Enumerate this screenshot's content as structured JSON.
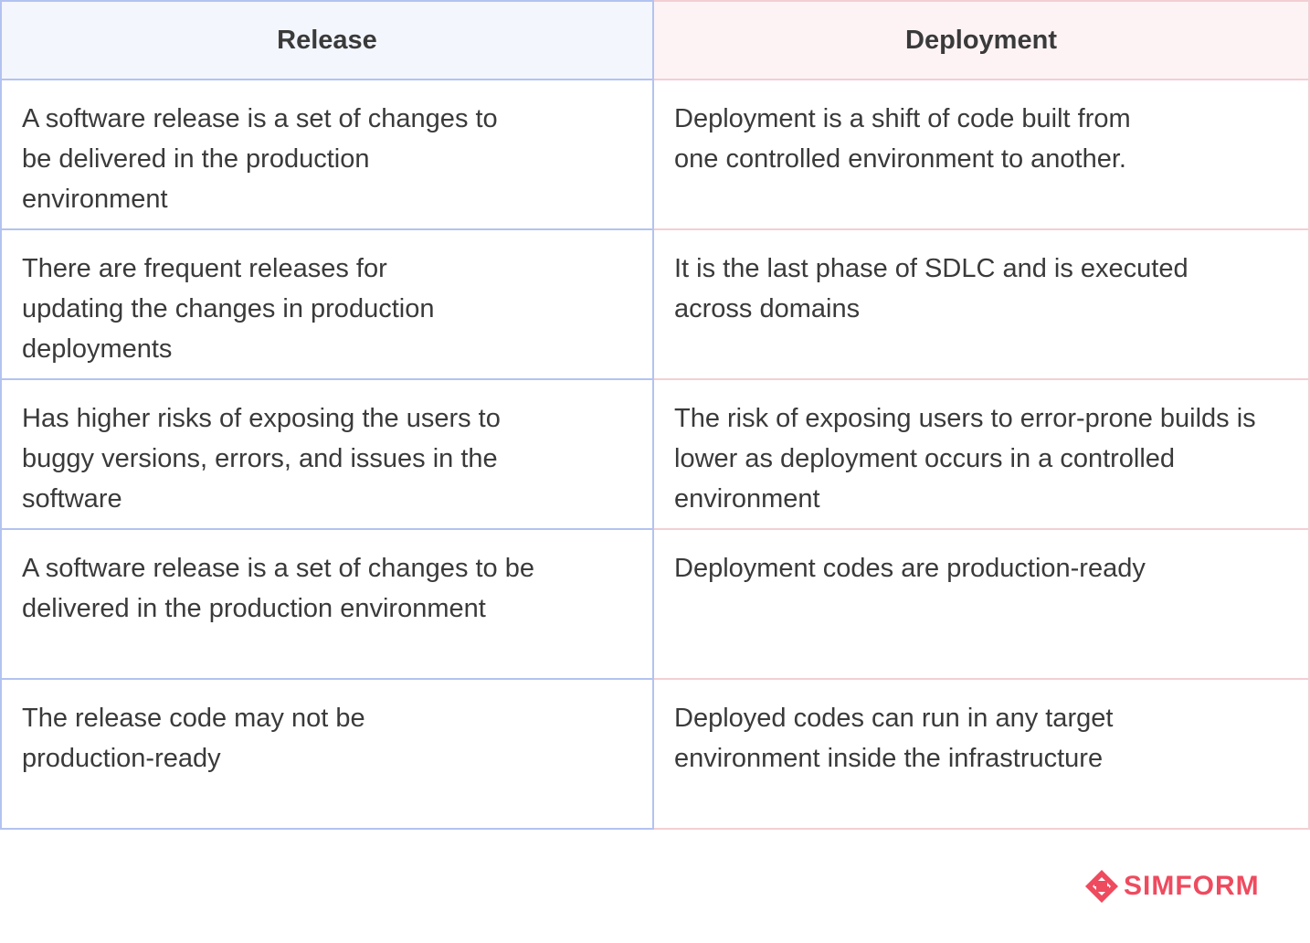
{
  "table": {
    "headers": {
      "release": "Release",
      "deployment": "Deployment"
    },
    "rows": [
      {
        "release": "A software release is a set of changes to be delivered in the production environment",
        "deployment": "Deployment is a shift of code built from one controlled environment to another."
      },
      {
        "release": "There are frequent releases for updating the changes in production deployments",
        "deployment": "It is the last phase of SDLC and is executed across domains"
      },
      {
        "release": "Has higher risks of exposing the users to buggy versions, errors, and issues in the software",
        "deployment": "The risk of exposing users to error-prone builds is lower as deployment occurs in a controlled environment"
      },
      {
        "release": "A software release is a set of changes to be delivered in the production environment",
        "deployment": "Deployment codes are production-ready"
      },
      {
        "release": "The release code may not be production-ready",
        "deployment": "Deployed codes can run in any target environment inside the infrastructure"
      }
    ]
  },
  "logo": {
    "text": "SIMFORM",
    "icon": "simform-logo-icon",
    "color": "#ee4b5f"
  },
  "colors": {
    "release_border": "#b3c3f0",
    "release_header_bg": "#f3f6fd",
    "deployment_border": "#f2cfd4",
    "deployment_header_bg": "#fdf3f5",
    "text": "#3a3a3a"
  }
}
